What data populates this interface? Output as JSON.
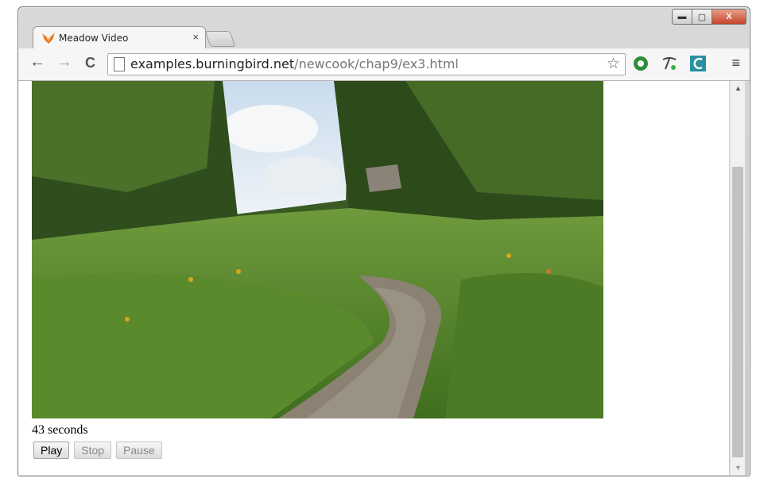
{
  "tab": {
    "title": "Meadow Video",
    "close_symbol": "×"
  },
  "window_controls": {
    "minimize": "▬",
    "maximize": "▢",
    "close": "X"
  },
  "nav": {
    "back": "←",
    "forward": "→",
    "reload": "C"
  },
  "address_bar": {
    "domain": "examples.burningbird.net",
    "path": "/newcook/chap9/ex3.html",
    "star": "☆"
  },
  "menu_symbol": "≡",
  "page": {
    "status_text": "43 seconds",
    "buttons": {
      "play": "Play",
      "stop": "Stop",
      "pause": "Pause"
    }
  },
  "scrollbar": {
    "up": "▲",
    "down": "▼"
  },
  "colors": {
    "tab_icon": "#e8742c",
    "extension_green": "#2f8d3a",
    "extension_teal": "#2a8fa1"
  }
}
